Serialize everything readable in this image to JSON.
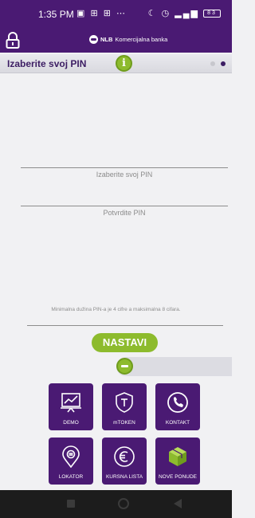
{
  "status_bar": {
    "time": "1:35 PM",
    "battery": "83"
  },
  "app_bar": {
    "brand_bold": "NLB",
    "brand_name": "Komercijalna banka"
  },
  "pin_header": {
    "title": "Izaberite svoj PIN"
  },
  "form": {
    "pin_placeholder": "Izaberite svoj PIN",
    "confirm_placeholder": "Potvrdite PIN",
    "hint": "Minimalna dužina PIN-a je 4 cifre a maksimalna 8 cifara.",
    "submit_label": "NASTAVI"
  },
  "tiles": [
    {
      "label": "DEMO",
      "icon": "chart-icon"
    },
    {
      "label": "mTOKEN",
      "icon": "shield-token-icon"
    },
    {
      "label": "KONTAKT",
      "icon": "phone-icon"
    },
    {
      "label": "LOKATOR",
      "icon": "location-pin-icon"
    },
    {
      "label": "KURSNA LISTA",
      "icon": "euro-icon"
    },
    {
      "label": "NOVE PONUDE",
      "icon": "box-icon"
    }
  ],
  "colors": {
    "brand_purple": "#4a1a73",
    "accent_green": "#8dbb2d"
  }
}
